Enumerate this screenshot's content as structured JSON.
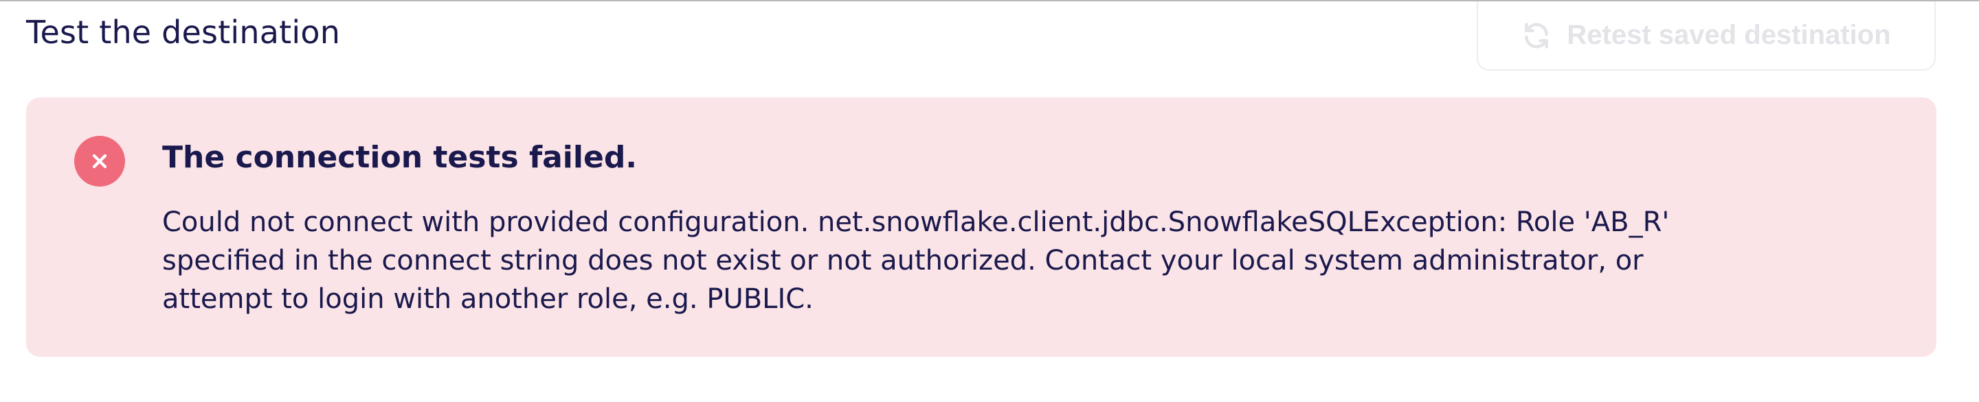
{
  "section": {
    "title": "Test the destination"
  },
  "retest_button": {
    "label": "Retest saved destination",
    "icon": "refresh-icon",
    "disabled": true
  },
  "alert": {
    "type": "error",
    "icon": "close-circle-icon",
    "title": "The connection tests failed.",
    "message_lines": [
      "Could not connect with provided configuration. net.snowflake.client.jdbc.SnowflakeSQLException: Role 'AB_R'",
      "specified in the connect string does not exist or not authorized. Contact your local system administrator, or",
      "attempt to login with another role, e.g. PUBLIC."
    ]
  },
  "colors": {
    "text_primary": "#1a194d",
    "alert_background": "#fbe4e7",
    "error_icon": "#ef6a7b",
    "disabled_text": "#e3e3e8",
    "button_border": "#ededf1"
  }
}
